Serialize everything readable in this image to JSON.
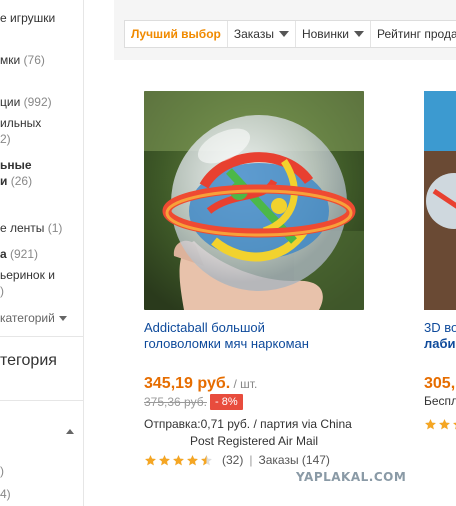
{
  "sidebar": {
    "items": [
      {
        "label": "е игрушки",
        "count": ""
      },
      {
        "label": "мки ",
        "count": "(76)"
      },
      {
        "label": "ции ",
        "count": "(992)"
      },
      {
        "label": "ильных",
        "count": ""
      },
      {
        "label": "2)",
        "count": ""
      },
      {
        "label": "ьные",
        "count": ""
      },
      {
        "label": "и ",
        "count": "(26)"
      },
      {
        "label": "е ленты ",
        "count": "(1)"
      },
      {
        "label": "а ",
        "count": "(921)"
      },
      {
        "label": "ьеринок и",
        "count": ""
      },
      {
        "label": ")",
        "count": ""
      }
    ],
    "more_label": "категорий",
    "heading": "тегория",
    "bottom_items": [
      ")",
      "4)"
    ]
  },
  "sortbar": {
    "tabs": [
      {
        "label": "Лучший выбор",
        "active": true,
        "caret": false
      },
      {
        "label": "Заказы",
        "active": false,
        "caret": true
      },
      {
        "label": "Новинки",
        "active": false,
        "caret": true
      },
      {
        "label": "Рейтинг прода",
        "active": false,
        "caret": false
      }
    ]
  },
  "product": {
    "title": "Addictaball большой головоломки мяч наркоман",
    "price": "345,19 руб.",
    "price_unit": " / шт.",
    "old_price": "375,36 руб.",
    "discount": "- 8%",
    "shipping_line1": "Отправка:0,71 руб. / партия via China",
    "shipping_line2": "Post Registered Air Mail",
    "rating_stars": 4.5,
    "reviews": "(32)",
    "separator": "|",
    "orders": "Заказы (147)",
    "star_color": "#f5a623"
  },
  "product2": {
    "title_line1": "3D во",
    "title_line2": "лаби",
    "price": "305,",
    "free": "Беспл"
  },
  "watermark": "YAPLAKAL.COM"
}
